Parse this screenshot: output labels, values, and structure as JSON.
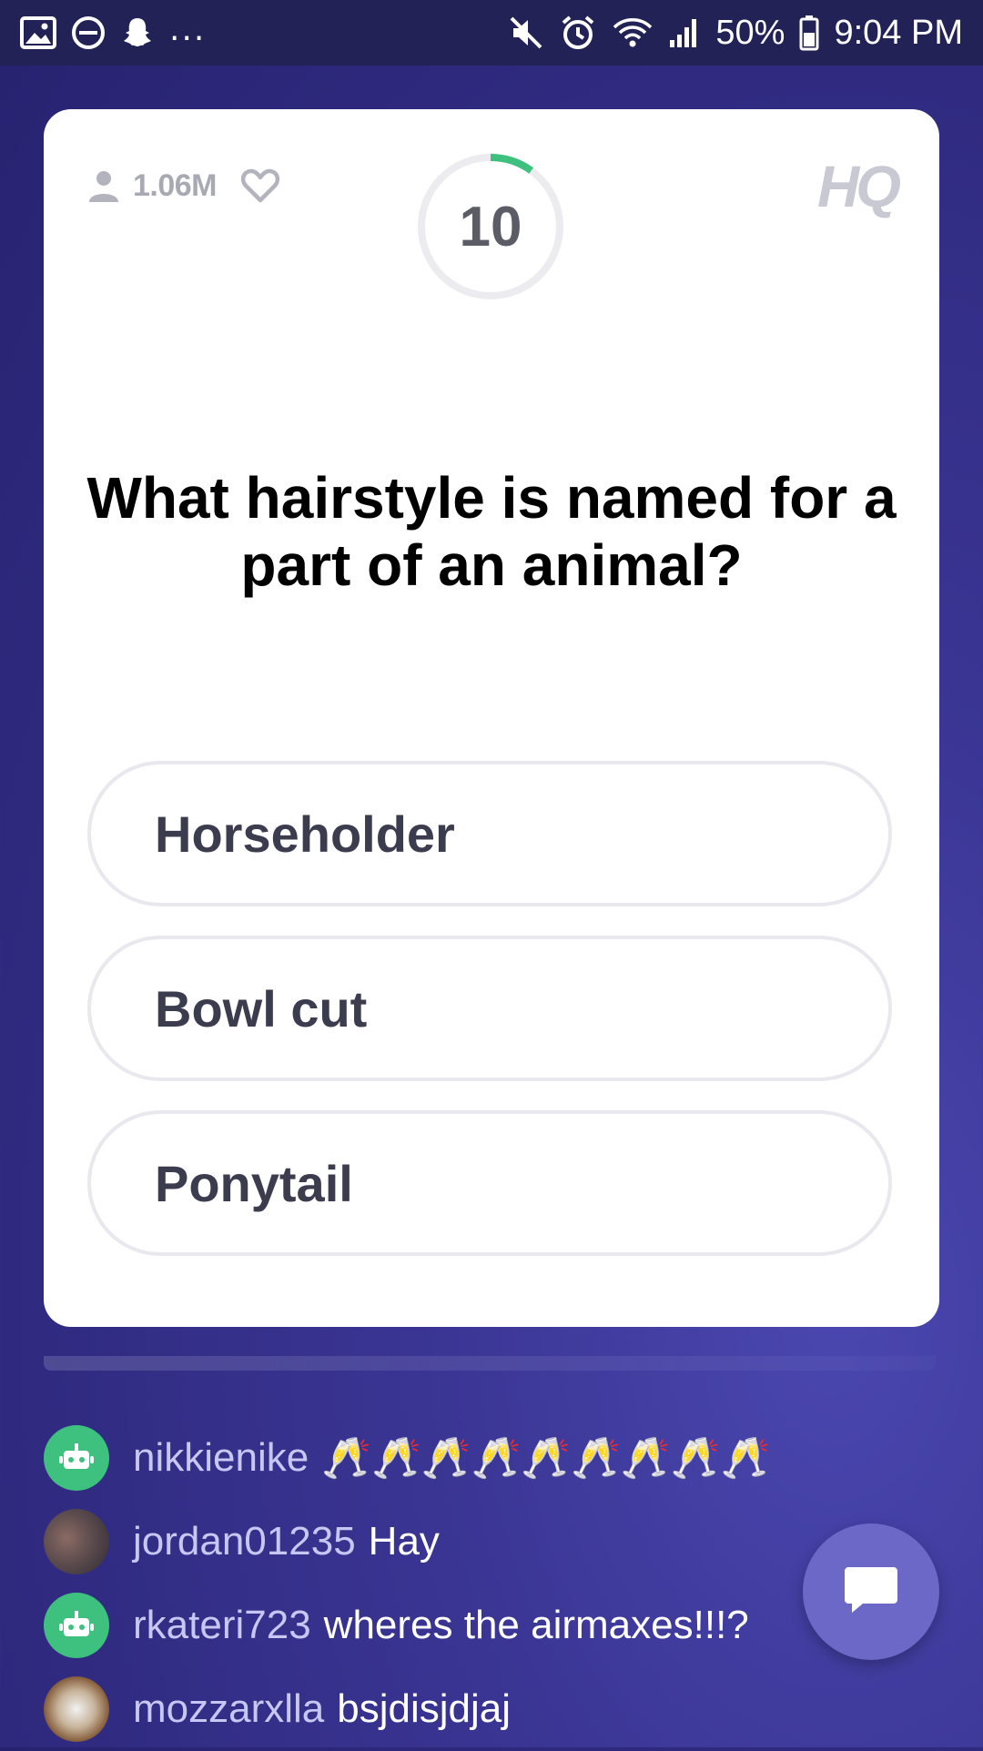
{
  "status_bar": {
    "left_icons": [
      "gallery-icon",
      "do-not-disturb-icon",
      "snapchat-icon"
    ],
    "overflow": "...",
    "battery_percent": "50%",
    "time": "9:04 PM"
  },
  "card": {
    "viewer_count": "1.06M",
    "timer_value": "10",
    "timer_progress": 0.1,
    "logo": "HQ",
    "question": "What hairstyle is named for a part of an animal?",
    "answers": [
      "Horseholder",
      "Bowl cut",
      "Ponytail"
    ]
  },
  "chat": {
    "messages": [
      {
        "user": "nikkienike",
        "text": "🥂🥂🥂🥂🥂🥂🥂🥂🥂",
        "avatar": "bot"
      },
      {
        "user": "jordan01235",
        "text": "Hay",
        "avatar": "photo"
      },
      {
        "user": "rkateri723",
        "text": "wheres the airmaxes!!!?",
        "avatar": "bot"
      },
      {
        "user": "mozzarxlla",
        "text": "bsjdisjdjaj",
        "avatar": "photo"
      }
    ]
  },
  "colors": {
    "background": "#2f2a7f",
    "status_bar": "#232257",
    "timer_arc": "#3ec07f",
    "chat_button": "#6c68c7",
    "bot_avatar": "#3ec07f"
  }
}
